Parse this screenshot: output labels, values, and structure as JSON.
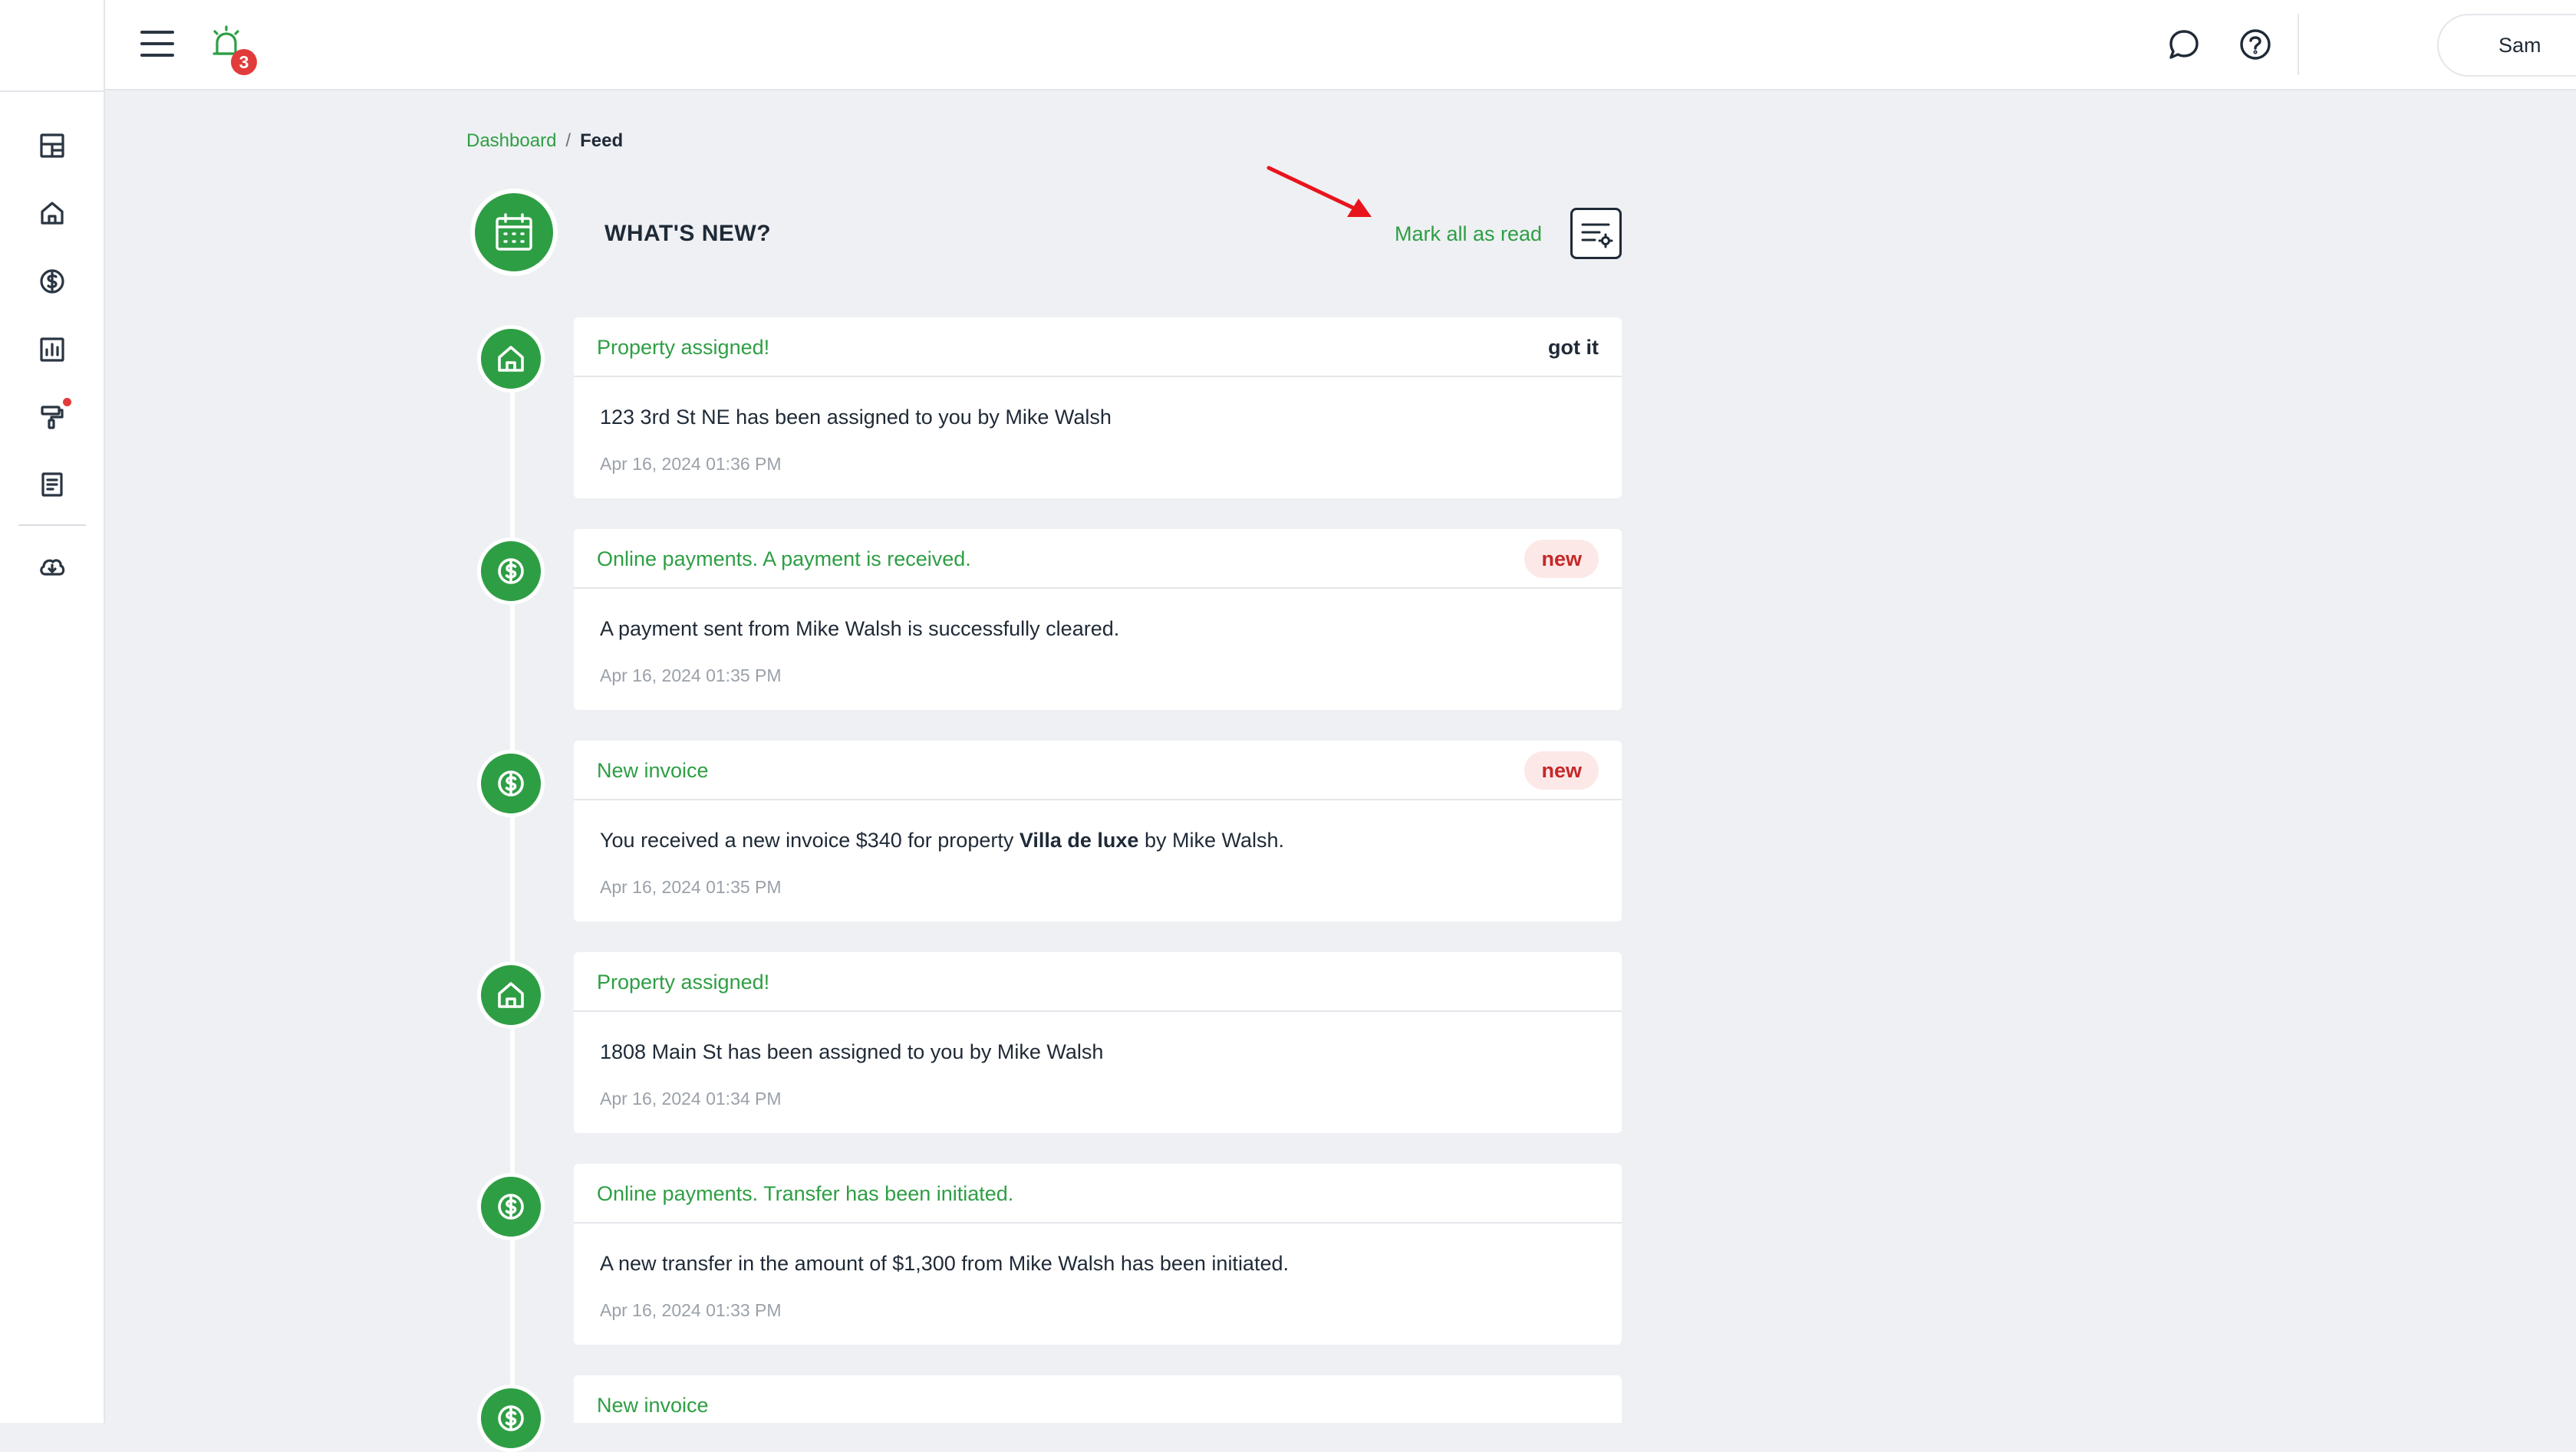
{
  "sidebar": {
    "items": [
      {
        "icon": "dashboard-icon"
      },
      {
        "icon": "home-icon"
      },
      {
        "icon": "dollar-icon"
      },
      {
        "icon": "chart-icon"
      },
      {
        "icon": "paint-roller-icon",
        "notify": true
      },
      {
        "icon": "document-icon"
      },
      {
        "icon": "cloud-download-icon"
      }
    ]
  },
  "topbar": {
    "alarm_count": "3",
    "user_name": "Sam"
  },
  "breadcrumb": {
    "root": "Dashboard",
    "separator": "/",
    "current": "Feed"
  },
  "header": {
    "title": "WHAT'S NEW?",
    "mark_all_read": "Mark all as read"
  },
  "feed": [
    {
      "title": "Property assigned!",
      "action": "got it",
      "message": "123 3rd St NE has been assigned to you by Mike Walsh",
      "time": "Apr 16, 2024 01:36 PM",
      "icon": "home-icon"
    },
    {
      "title": "Online payments. A payment is received.",
      "badge": "new",
      "message": "A payment sent from Mike Walsh is successfully cleared.",
      "time": "Apr 16, 2024 01:35 PM",
      "icon": "dollar-icon"
    },
    {
      "title": "New invoice",
      "badge": "new",
      "message_pre": "You received a new invoice $340 for property ",
      "message_bold": "Villa de luxe",
      "message_post": " by Mike Walsh.",
      "time": "Apr 16, 2024 01:35 PM",
      "icon": "dollar-icon"
    },
    {
      "title": "Property assigned!",
      "message": "1808 Main St has been assigned to you by Mike Walsh",
      "time": "Apr 16, 2024 01:34 PM",
      "icon": "home-icon"
    },
    {
      "title": "Online payments. Transfer has been initiated.",
      "message": "A new transfer in the amount of $1,300 from Mike Walsh has been initiated.",
      "time": "Apr 16, 2024 01:33 PM",
      "icon": "dollar-icon"
    },
    {
      "title": "New invoice",
      "icon": "dollar-icon"
    }
  ],
  "colors": {
    "accent": "#2e9e44",
    "badge_bg": "#fde8e8",
    "badge_text": "#c62828",
    "alert": "#e23b3b",
    "annotation_arrow": "#e8141c"
  }
}
